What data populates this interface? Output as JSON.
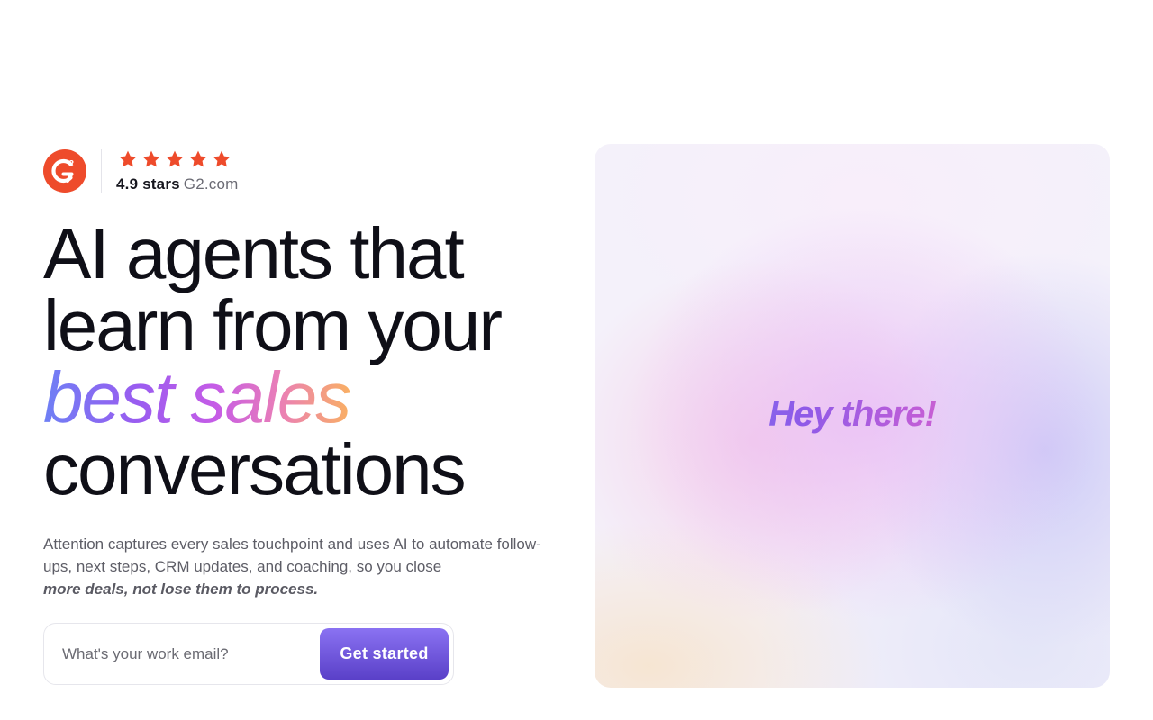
{
  "rating": {
    "logo": "g2-logo",
    "star_icon": "star-icon",
    "star_color": "#ee4b2b",
    "stars": 5,
    "score": "4.9 stars",
    "source": "G2.com"
  },
  "headline": {
    "line1": "AI agents that",
    "line2": "learn from your",
    "accent": "best sales",
    "line4": "conversations"
  },
  "subtext": {
    "body": "Attention captures every sales touchpoint and uses AI to automate follow-ups, next steps, CRM updates, and coaching, so you close",
    "emphasis": "more deals, not lose them to process."
  },
  "form": {
    "email_placeholder": "What's your work email?",
    "email_value": "",
    "cta_label": "Get started"
  },
  "visual": {
    "greeting": "Hey there!"
  },
  "colors": {
    "brand_red": "#ee4b2b",
    "cta_top": "#8a72f2",
    "cta_bottom": "#5a40c8"
  }
}
